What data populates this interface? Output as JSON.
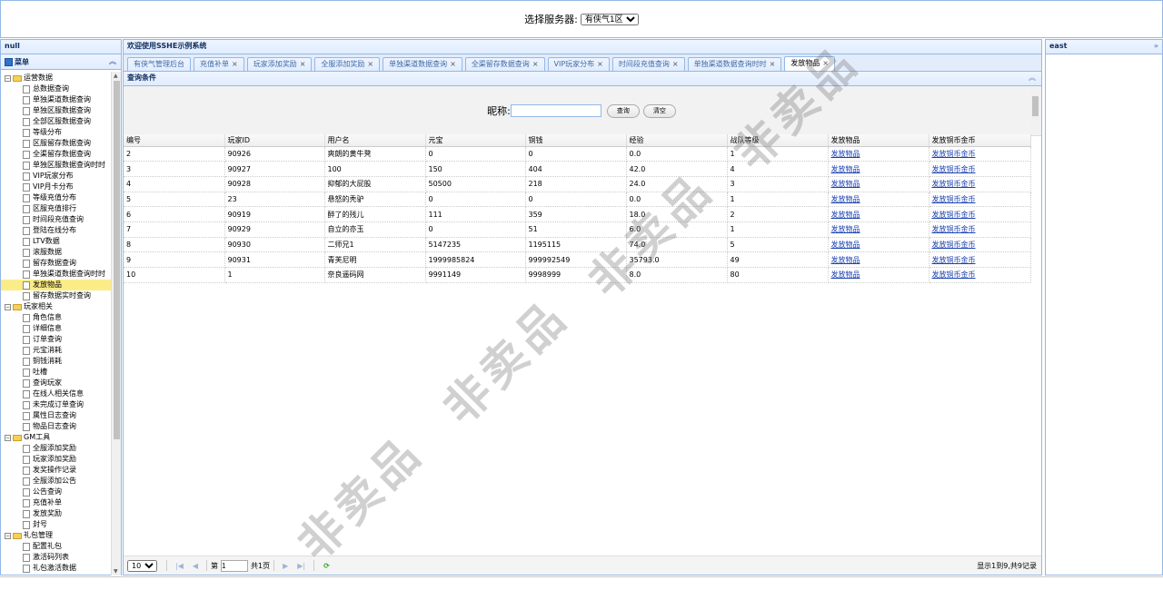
{
  "north": {
    "label": "选择服务器:",
    "server": "有侠气1区"
  },
  "west": {
    "title": "null",
    "menu_title": "菜单",
    "tree": [
      {
        "type": "folder",
        "label": "运营数据"
      },
      {
        "type": "leaf",
        "label": "总数据查询"
      },
      {
        "type": "leaf",
        "label": "单独渠道数据查询"
      },
      {
        "type": "leaf",
        "label": "单独区服数据查询"
      },
      {
        "type": "leaf",
        "label": "全部区服数据查询"
      },
      {
        "type": "leaf",
        "label": "等级分布"
      },
      {
        "type": "leaf",
        "label": "区服留存数据查询"
      },
      {
        "type": "leaf",
        "label": "全渠留存数据查询"
      },
      {
        "type": "leaf",
        "label": "单独区服数据查询时时"
      },
      {
        "type": "leaf",
        "label": "VIP玩家分布"
      },
      {
        "type": "leaf",
        "label": "VIP月卡分布"
      },
      {
        "type": "leaf",
        "label": "等级充值分布"
      },
      {
        "type": "leaf",
        "label": "区服充值排行"
      },
      {
        "type": "leaf",
        "label": "时间段充值查询"
      },
      {
        "type": "leaf",
        "label": "登陆在线分布"
      },
      {
        "type": "leaf",
        "label": "LTV数据"
      },
      {
        "type": "leaf",
        "label": "滚服数据"
      },
      {
        "type": "leaf",
        "label": "留存数据查询"
      },
      {
        "type": "leaf",
        "label": "单独渠道数据查询时时"
      },
      {
        "type": "leaf",
        "label": "发放物品",
        "selected": true
      },
      {
        "type": "leaf",
        "label": "留存数据实时查询"
      },
      {
        "type": "folder",
        "label": "玩家相关"
      },
      {
        "type": "leaf",
        "label": "角色信息"
      },
      {
        "type": "leaf",
        "label": "详细信息"
      },
      {
        "type": "leaf",
        "label": "订单查询"
      },
      {
        "type": "leaf",
        "label": "元宝消耗"
      },
      {
        "type": "leaf",
        "label": "铜钱消耗"
      },
      {
        "type": "leaf",
        "label": "吐槽"
      },
      {
        "type": "leaf",
        "label": "查询玩家"
      },
      {
        "type": "leaf",
        "label": "在线人相关信息"
      },
      {
        "type": "leaf",
        "label": "未完成订单查询"
      },
      {
        "type": "leaf",
        "label": "属性日志查询"
      },
      {
        "type": "leaf",
        "label": "物品日志查询"
      },
      {
        "type": "folder",
        "label": "GM工具"
      },
      {
        "type": "leaf",
        "label": "全服添加奖励"
      },
      {
        "type": "leaf",
        "label": "玩家添加奖励"
      },
      {
        "type": "leaf",
        "label": "发奖操作记录"
      },
      {
        "type": "leaf",
        "label": "全服添加公告"
      },
      {
        "type": "leaf",
        "label": "公告查询"
      },
      {
        "type": "leaf",
        "label": "充值补单"
      },
      {
        "type": "leaf",
        "label": "发放奖励"
      },
      {
        "type": "leaf",
        "label": "封号"
      },
      {
        "type": "folder",
        "label": "礼包管理"
      },
      {
        "type": "leaf",
        "label": "配置礼包"
      },
      {
        "type": "leaf",
        "label": "激活码列表"
      },
      {
        "type": "leaf",
        "label": "礼包激活数据"
      }
    ]
  },
  "center": {
    "title": "欢迎使用SSHE示例系统",
    "tabs": [
      {
        "label": "有侠气管理后台",
        "closable": false
      },
      {
        "label": "充值补单",
        "closable": true
      },
      {
        "label": "玩家添加奖励",
        "closable": true
      },
      {
        "label": "全服添加奖励",
        "closable": true
      },
      {
        "label": "单独渠道数据查询",
        "closable": true
      },
      {
        "label": "全渠留存数据查询",
        "closable": true
      },
      {
        "label": "VIP玩家分布",
        "closable": true
      },
      {
        "label": "时间段充值查询",
        "closable": true
      },
      {
        "label": "单独渠道数据查询时时",
        "closable": true
      },
      {
        "label": "发放物品",
        "closable": true,
        "active": true
      }
    ],
    "query": {
      "title": "查询条件",
      "nickname_label": "昵称:",
      "nickname_value": "",
      "search_label": "查询",
      "clear_label": "清空"
    },
    "table": {
      "columns": [
        "编号",
        "玩家ID",
        "用户名",
        "元宝",
        "铜钱",
        "经验",
        "战队等级",
        "发放物品",
        "发放铜币金币"
      ],
      "rows": [
        [
          "2",
          "90926",
          "爽朗的黄牛凳",
          "0",
          "0",
          "0.0",
          "1",
          "发放物品",
          "发放铜币金币"
        ],
        [
          "3",
          "90927",
          "100",
          "150",
          "404",
          "42.0",
          "4",
          "发放物品",
          "发放铜币金币"
        ],
        [
          "4",
          "90928",
          "抑郁的大屁股",
          "50500",
          "218",
          "24.0",
          "3",
          "发放物品",
          "发放铜币金币"
        ],
        [
          "5",
          "23",
          "悬怒的秃驴",
          "0",
          "0",
          "0.0",
          "1",
          "发放物品",
          "发放铜币金币"
        ],
        [
          "6",
          "90919",
          "醉了的残儿",
          "111",
          "359",
          "18.0",
          "2",
          "发放物品",
          "发放铜币金币"
        ],
        [
          "7",
          "90929",
          "自立的亦玉",
          "0",
          "51",
          "6.0",
          "1",
          "发放物品",
          "发放铜币金币"
        ],
        [
          "8",
          "90930",
          "二师兄1",
          "5147235",
          "1195115",
          "74.0",
          "5",
          "发放物品",
          "发放铜币金币"
        ],
        [
          "9",
          "90931",
          "青芙尼明",
          "1999985824",
          "999992549",
          "35793.0",
          "49",
          "发放物品",
          "发放铜币金币"
        ],
        [
          "10",
          "1",
          "奈良遥码网",
          "9991149",
          "9998999",
          "8.0",
          "80",
          "发放物品",
          "发放铜币金币"
        ]
      ]
    },
    "pager": {
      "page_size": "10",
      "page_prefix": "第",
      "page_value": "1",
      "page_suffix": "共1页",
      "info": "显示1到9,共9记录"
    }
  },
  "east": {
    "title": "east",
    "expand_icon": "double-chevron-right-icon"
  },
  "watermark": "非卖品"
}
